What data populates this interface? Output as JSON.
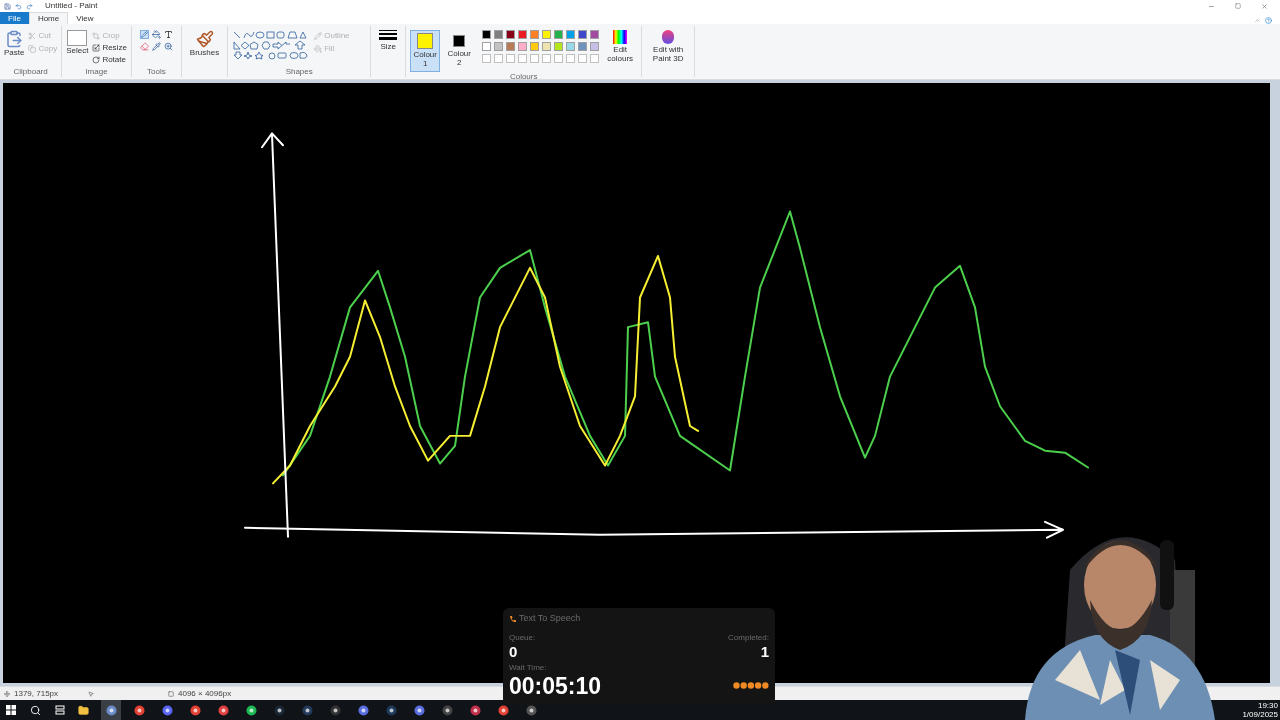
{
  "window": {
    "title": "Untitled - Paint"
  },
  "tabs": [
    {
      "label": "File",
      "kind": "file",
      "selected": false
    },
    {
      "label": "Home",
      "kind": "tab",
      "selected": true
    },
    {
      "label": "View",
      "kind": "tab",
      "selected": false
    }
  ],
  "ribbon": {
    "clipboard": {
      "label": "Clipboard",
      "paste": "Paste",
      "cut": {
        "label": "Cut",
        "disabled": true
      },
      "copy": {
        "label": "Copy",
        "disabled": true
      }
    },
    "image": {
      "label": "Image",
      "select": "Select",
      "crop": "Crop",
      "resize": "Resize",
      "rotate": "Rotate"
    },
    "tools": {
      "label": "Tools"
    },
    "brushes": "Brushes",
    "shapes": {
      "label": "Shapes",
      "outline": {
        "label": "Outline",
        "disabled": true
      },
      "fill": {
        "label": "Fill",
        "disabled": true
      }
    },
    "size": "Size",
    "colours": {
      "label": "Colours",
      "colour_1": {
        "label": "Colour 1",
        "color": "#fff200",
        "selected": true
      },
      "colour_2": {
        "label": "Colour 2",
        "color": "#000000",
        "selected": false
      },
      "palette": [
        {
          "color": "#000000"
        },
        {
          "color": "#7f7f7f"
        },
        {
          "color": "#880015"
        },
        {
          "color": "#ed1c24"
        },
        {
          "color": "#ff7f27"
        },
        {
          "color": "#fff200"
        },
        {
          "color": "#22b14c"
        },
        {
          "color": "#00a2e8"
        },
        {
          "color": "#3f48cc"
        },
        {
          "color": "#a349a4"
        },
        {
          "color": "#ffffff"
        },
        {
          "color": "#c3c3c3"
        },
        {
          "color": "#b97a57"
        },
        {
          "color": "#ffaec9"
        },
        {
          "color": "#ffc90e"
        },
        {
          "color": "#efe4b0"
        },
        {
          "color": "#b5e61d"
        },
        {
          "color": "#99d9ea"
        },
        {
          "color": "#7092be"
        },
        {
          "color": "#c8bfe7"
        }
      ],
      "edit_colours": "Edit colours"
    },
    "edit_3d": "Edit with Paint 3D"
  },
  "status_bar": {
    "cursor": "1379, 715px",
    "canvas_size": "4096 × 4096px"
  },
  "tts_overlay": {
    "title": "Text To Speech",
    "queue_label": "Queue:",
    "queue": "0",
    "completed_label": "Completed:",
    "completed": "1",
    "wait_label": "Wait Time:",
    "wait": "00:05:10"
  },
  "taskbar": {
    "time": "19:30",
    "date": "1/09/2025"
  }
}
